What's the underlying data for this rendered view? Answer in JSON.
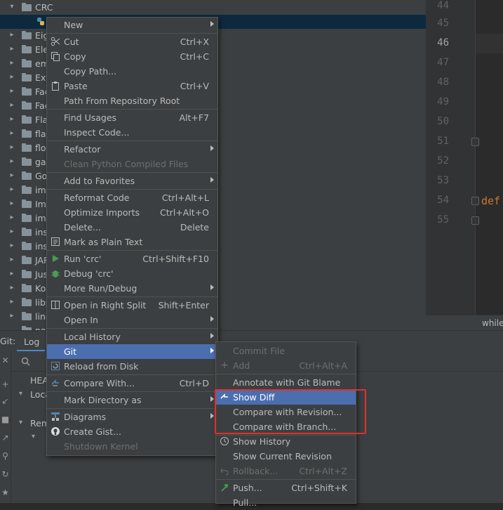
{
  "project_tree": {
    "items": [
      {
        "label": "CRC",
        "expanded": true
      },
      {
        "label": "",
        "selected": true,
        "icon": "python-file-icon"
      },
      {
        "label": "Eig"
      },
      {
        "label": "Ele"
      },
      {
        "label": "em"
      },
      {
        "label": "Ext"
      },
      {
        "label": "Fac"
      },
      {
        "label": "Fac"
      },
      {
        "label": "Fla"
      },
      {
        "label": "flap"
      },
      {
        "label": "flo"
      },
      {
        "label": "ga"
      },
      {
        "label": "Go"
      },
      {
        "label": "ima"
      },
      {
        "label": "Im"
      },
      {
        "label": "img"
      },
      {
        "label": "ins"
      },
      {
        "label": "ins"
      },
      {
        "label": "JAR"
      },
      {
        "label": "Jus"
      },
      {
        "label": "Ko"
      },
      {
        "label": "libs"
      },
      {
        "label": "line"
      },
      {
        "label": "nor"
      }
    ]
  },
  "editor": {
    "line_numbers": [
      "44",
      "45",
      "46",
      "47",
      "48",
      "49",
      "50",
      "51",
      "52",
      "53",
      "54",
      "55"
    ],
    "current_line": "46",
    "code_keyword": "def",
    "breadcrumb": "while"
  },
  "git_panel": {
    "tool_label": "Git:",
    "tab_log": "Log",
    "branches": {
      "head": "HEA",
      "local": "Loca",
      "remote": "Rem"
    }
  },
  "context_menu": {
    "items": [
      {
        "label": "New",
        "submenu": true
      },
      {
        "label": "Cut",
        "shortcut": "Ctrl+X",
        "icon": "scissors-icon"
      },
      {
        "label": "Copy",
        "shortcut": "Ctrl+C",
        "icon": "copy-icon"
      },
      {
        "label": "Copy Path..."
      },
      {
        "label": "Paste",
        "shortcut": "Ctrl+V",
        "icon": "clipboard-icon"
      },
      {
        "label": "Path From Repository Root"
      },
      {
        "label": "Find Usages",
        "shortcut": "Alt+F7"
      },
      {
        "label": "Inspect Code..."
      },
      {
        "label": "Refactor",
        "submenu": true
      },
      {
        "label": "Clean Python Compiled Files",
        "disabled": true
      },
      {
        "label": "Add to Favorites",
        "submenu": true
      },
      {
        "label": "Reformat Code",
        "shortcut": "Ctrl+Alt+L"
      },
      {
        "label": "Optimize Imports",
        "shortcut": "Ctrl+Alt+O"
      },
      {
        "label": "Delete...",
        "shortcut": "Delete"
      },
      {
        "label": "Mark as Plain Text",
        "icon": "plain-text-icon"
      },
      {
        "label": "Run 'crc'",
        "shortcut": "Ctrl+Shift+F10",
        "icon": "run-icon"
      },
      {
        "label": "Debug 'crc'",
        "icon": "debug-icon"
      },
      {
        "label": "More Run/Debug",
        "submenu": true
      },
      {
        "label": "Open in Right Split",
        "shortcut": "Shift+Enter",
        "icon": "split-icon"
      },
      {
        "label": "Open In",
        "submenu": true
      },
      {
        "label": "Local History",
        "submenu": true
      },
      {
        "label": "Git",
        "submenu": true,
        "highlighted": true
      },
      {
        "label": "Reload from Disk",
        "icon": "reload-icon"
      },
      {
        "label": "Compare With...",
        "shortcut": "Ctrl+D",
        "icon": "compare-icon"
      },
      {
        "label": "Mark Directory as",
        "submenu": true
      },
      {
        "label": "Diagrams",
        "submenu": true,
        "icon": "diagram-icon"
      },
      {
        "label": "Create Gist...",
        "icon": "github-icon"
      },
      {
        "label": "Shutdown Kernel",
        "disabled": true
      }
    ]
  },
  "git_menu": {
    "items": [
      {
        "label": "Commit File",
        "disabled": true
      },
      {
        "label": "Add",
        "shortcut": "Ctrl+Alt+A",
        "disabled": true,
        "icon": "plus-icon"
      },
      {
        "label": "Annotate with Git Blame"
      },
      {
        "label": "Show Diff",
        "highlighted": true,
        "icon": "diff-icon"
      },
      {
        "label": "Compare with Revision..."
      },
      {
        "label": "Compare with Branch..."
      },
      {
        "label": "Show History",
        "icon": "history-icon"
      },
      {
        "label": "Show Current Revision"
      },
      {
        "label": "Rollback...",
        "shortcut": "Ctrl+Alt+Z",
        "disabled": true,
        "icon": "rollback-icon"
      },
      {
        "label": "Push...",
        "shortcut": "Ctrl+Shift+K",
        "icon": "push-icon"
      },
      {
        "label": "Pull..."
      }
    ]
  },
  "colors": {
    "highlight": "#4b6eaf",
    "annotation_box": "#e0302a"
  }
}
